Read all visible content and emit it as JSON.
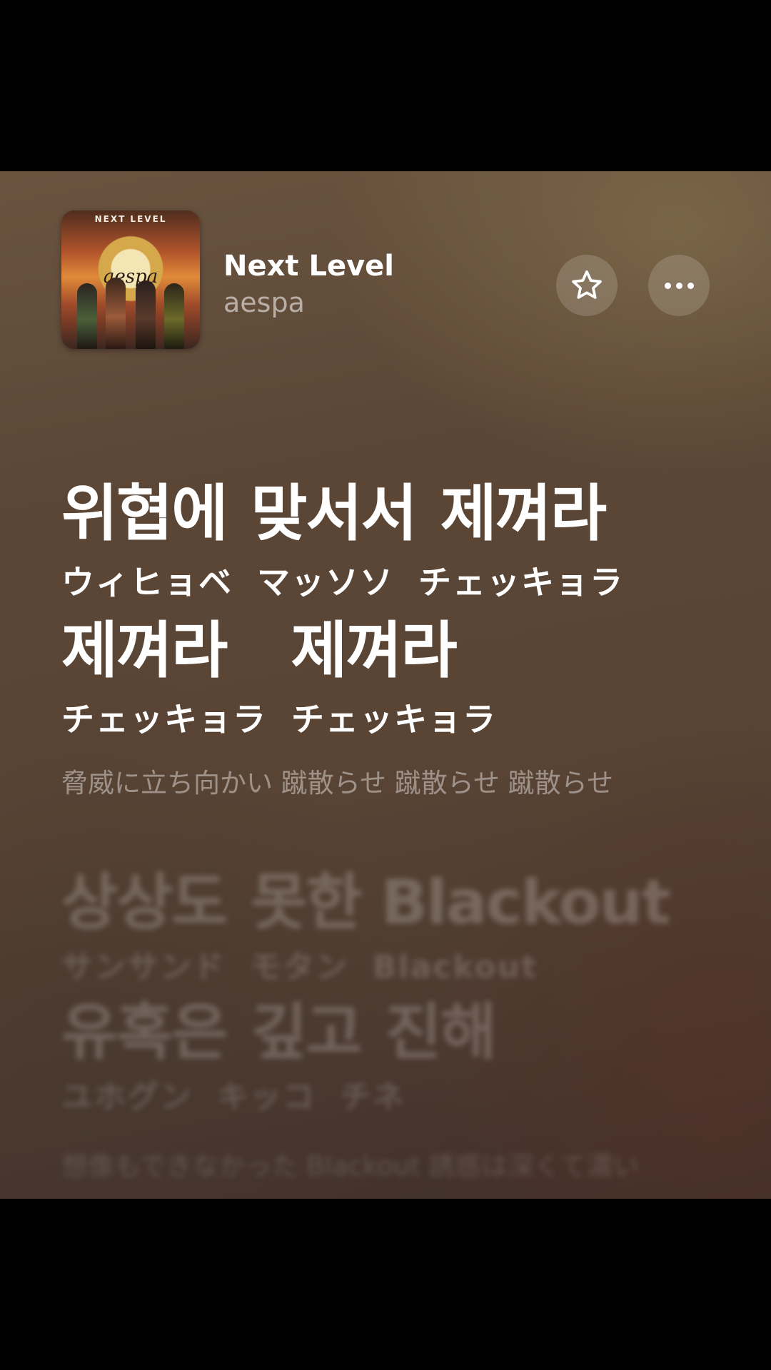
{
  "now_playing": {
    "artwork_title": "NEXT LEVEL",
    "artwork_logo": "aespa",
    "title": "Next Level",
    "artist": "aespa"
  },
  "actions": {
    "favorite_icon": "star-icon",
    "more_icon": "ellipsis-icon"
  },
  "lyrics": {
    "current": {
      "korean_1": [
        "위협에",
        "맞서서",
        "제껴라"
      ],
      "japanese_1": [
        "ウィヒョベ",
        "マッソソ",
        "チェッキョラ"
      ],
      "korean_2": [
        "제껴라",
        "제껴라"
      ],
      "japanese_2": [
        "チェッキョラ",
        "チェッキョラ"
      ],
      "translation": "脅威に立ち向かい 蹴散らせ 蹴散らせ 蹴散らせ"
    },
    "next": {
      "korean_1": [
        "상상도",
        "못한 Blackout"
      ],
      "japanese_1": [
        "サンサンド",
        "モタン",
        "Blackout"
      ],
      "korean_2": [
        "유혹은",
        "깊고",
        "진해"
      ],
      "japanese_2": [
        "ユホグン",
        "キッコ",
        "チネ"
      ],
      "translation": "想像もできなかった Blackout 誘惑は深くて濃い"
    }
  }
}
